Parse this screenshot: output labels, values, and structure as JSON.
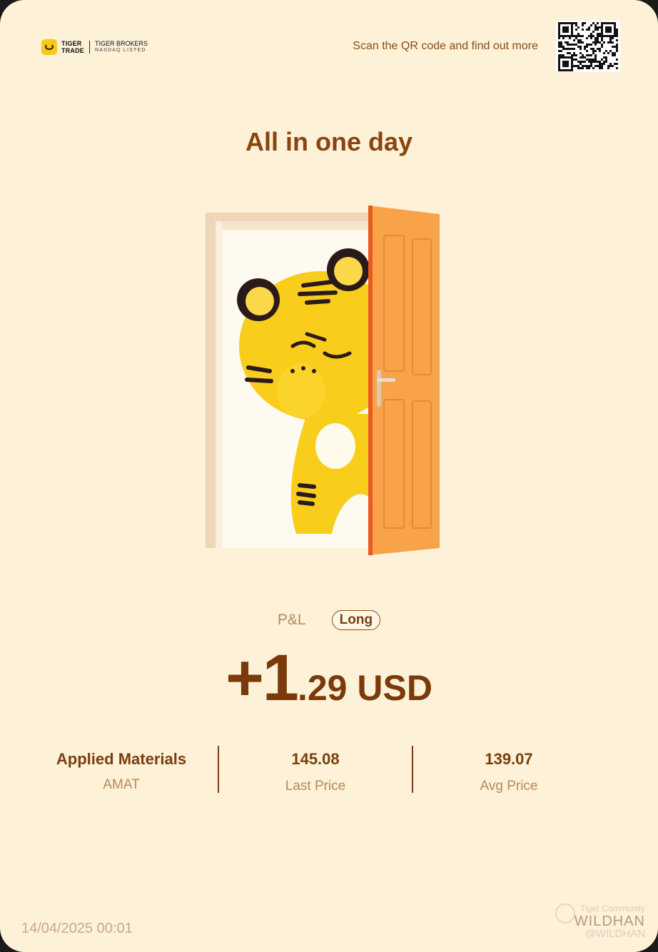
{
  "brand": {
    "name_line1": "TIGER",
    "name_line2": "TRADE",
    "broker": "TIGER BROKERS",
    "broker_sub": "NASDAQ LISTED"
  },
  "header": {
    "scan_text": "Scan the QR code and find out more"
  },
  "title": "All in one day",
  "pl": {
    "label": "P&L",
    "position": "Long",
    "amount_main": "+1",
    "amount_rest": ".29 USD"
  },
  "stock": {
    "name": "Applied Materials",
    "ticker": "AMAT"
  },
  "last_price": {
    "value": "145.08",
    "label": "Last Price"
  },
  "avg_price": {
    "value": "139.07",
    "label": "Avg Price"
  },
  "timestamp": "14/04/2025 00:01",
  "watermark": {
    "community": "Tiger Community",
    "user": "WILDHAN",
    "handle": "@WILDHAN"
  },
  "colors": {
    "background": "#fdf1d7",
    "primary_brown": "#7a3e0e",
    "muted": "#b88a5c",
    "door": "#f8a24a",
    "tiger": "#f9cd1b"
  }
}
